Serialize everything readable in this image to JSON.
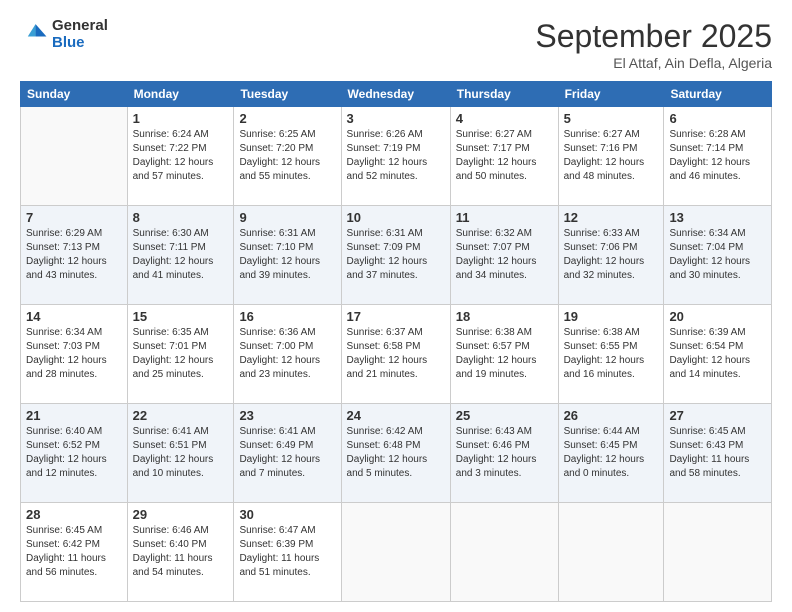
{
  "logo": {
    "general": "General",
    "blue": "Blue"
  },
  "title": "September 2025",
  "subtitle": "El Attaf, Ain Defla, Algeria",
  "weekdays": [
    "Sunday",
    "Monday",
    "Tuesday",
    "Wednesday",
    "Thursday",
    "Friday",
    "Saturday"
  ],
  "weeks": [
    [
      {
        "day": "",
        "info": ""
      },
      {
        "day": "1",
        "info": "Sunrise: 6:24 AM\nSunset: 7:22 PM\nDaylight: 12 hours\nand 57 minutes."
      },
      {
        "day": "2",
        "info": "Sunrise: 6:25 AM\nSunset: 7:20 PM\nDaylight: 12 hours\nand 55 minutes."
      },
      {
        "day": "3",
        "info": "Sunrise: 6:26 AM\nSunset: 7:19 PM\nDaylight: 12 hours\nand 52 minutes."
      },
      {
        "day": "4",
        "info": "Sunrise: 6:27 AM\nSunset: 7:17 PM\nDaylight: 12 hours\nand 50 minutes."
      },
      {
        "day": "5",
        "info": "Sunrise: 6:27 AM\nSunset: 7:16 PM\nDaylight: 12 hours\nand 48 minutes."
      },
      {
        "day": "6",
        "info": "Sunrise: 6:28 AM\nSunset: 7:14 PM\nDaylight: 12 hours\nand 46 minutes."
      }
    ],
    [
      {
        "day": "7",
        "info": "Sunrise: 6:29 AM\nSunset: 7:13 PM\nDaylight: 12 hours\nand 43 minutes."
      },
      {
        "day": "8",
        "info": "Sunrise: 6:30 AM\nSunset: 7:11 PM\nDaylight: 12 hours\nand 41 minutes."
      },
      {
        "day": "9",
        "info": "Sunrise: 6:31 AM\nSunset: 7:10 PM\nDaylight: 12 hours\nand 39 minutes."
      },
      {
        "day": "10",
        "info": "Sunrise: 6:31 AM\nSunset: 7:09 PM\nDaylight: 12 hours\nand 37 minutes."
      },
      {
        "day": "11",
        "info": "Sunrise: 6:32 AM\nSunset: 7:07 PM\nDaylight: 12 hours\nand 34 minutes."
      },
      {
        "day": "12",
        "info": "Sunrise: 6:33 AM\nSunset: 7:06 PM\nDaylight: 12 hours\nand 32 minutes."
      },
      {
        "day": "13",
        "info": "Sunrise: 6:34 AM\nSunset: 7:04 PM\nDaylight: 12 hours\nand 30 minutes."
      }
    ],
    [
      {
        "day": "14",
        "info": "Sunrise: 6:34 AM\nSunset: 7:03 PM\nDaylight: 12 hours\nand 28 minutes."
      },
      {
        "day": "15",
        "info": "Sunrise: 6:35 AM\nSunset: 7:01 PM\nDaylight: 12 hours\nand 25 minutes."
      },
      {
        "day": "16",
        "info": "Sunrise: 6:36 AM\nSunset: 7:00 PM\nDaylight: 12 hours\nand 23 minutes."
      },
      {
        "day": "17",
        "info": "Sunrise: 6:37 AM\nSunset: 6:58 PM\nDaylight: 12 hours\nand 21 minutes."
      },
      {
        "day": "18",
        "info": "Sunrise: 6:38 AM\nSunset: 6:57 PM\nDaylight: 12 hours\nand 19 minutes."
      },
      {
        "day": "19",
        "info": "Sunrise: 6:38 AM\nSunset: 6:55 PM\nDaylight: 12 hours\nand 16 minutes."
      },
      {
        "day": "20",
        "info": "Sunrise: 6:39 AM\nSunset: 6:54 PM\nDaylight: 12 hours\nand 14 minutes."
      }
    ],
    [
      {
        "day": "21",
        "info": "Sunrise: 6:40 AM\nSunset: 6:52 PM\nDaylight: 12 hours\nand 12 minutes."
      },
      {
        "day": "22",
        "info": "Sunrise: 6:41 AM\nSunset: 6:51 PM\nDaylight: 12 hours\nand 10 minutes."
      },
      {
        "day": "23",
        "info": "Sunrise: 6:41 AM\nSunset: 6:49 PM\nDaylight: 12 hours\nand 7 minutes."
      },
      {
        "day": "24",
        "info": "Sunrise: 6:42 AM\nSunset: 6:48 PM\nDaylight: 12 hours\nand 5 minutes."
      },
      {
        "day": "25",
        "info": "Sunrise: 6:43 AM\nSunset: 6:46 PM\nDaylight: 12 hours\nand 3 minutes."
      },
      {
        "day": "26",
        "info": "Sunrise: 6:44 AM\nSunset: 6:45 PM\nDaylight: 12 hours\nand 0 minutes."
      },
      {
        "day": "27",
        "info": "Sunrise: 6:45 AM\nSunset: 6:43 PM\nDaylight: 11 hours\nand 58 minutes."
      }
    ],
    [
      {
        "day": "28",
        "info": "Sunrise: 6:45 AM\nSunset: 6:42 PM\nDaylight: 11 hours\nand 56 minutes."
      },
      {
        "day": "29",
        "info": "Sunrise: 6:46 AM\nSunset: 6:40 PM\nDaylight: 11 hours\nand 54 minutes."
      },
      {
        "day": "30",
        "info": "Sunrise: 6:47 AM\nSunset: 6:39 PM\nDaylight: 11 hours\nand 51 minutes."
      },
      {
        "day": "",
        "info": ""
      },
      {
        "day": "",
        "info": ""
      },
      {
        "day": "",
        "info": ""
      },
      {
        "day": "",
        "info": ""
      }
    ]
  ]
}
